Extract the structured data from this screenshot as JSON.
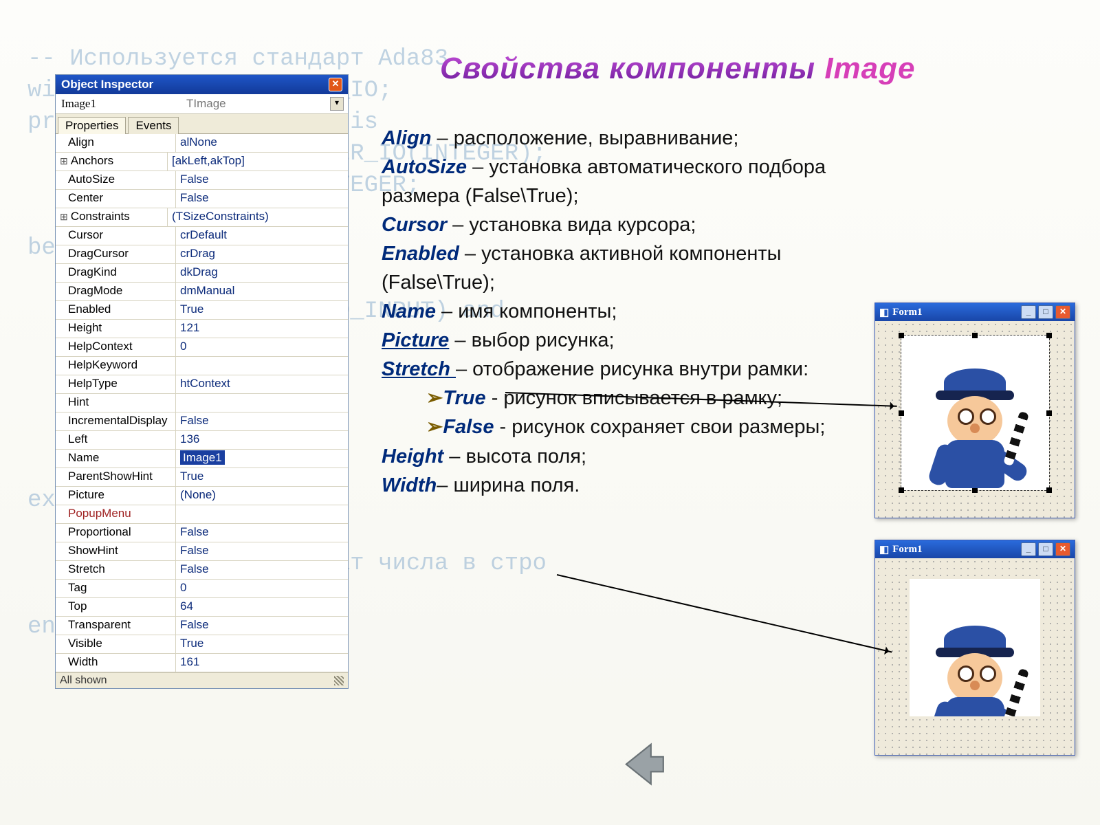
{
  "title": {
    "part1": "Свойства компоненты ",
    "part2": "Image"
  },
  "desc": {
    "align": {
      "k": "Align",
      "v": "расположение, выравнивание;"
    },
    "autosize": {
      "k": "AutoSize",
      "v": "установка автоматического подбора размера (False\\True);"
    },
    "cursor": {
      "k": "Cursor",
      "v": "установка вида курсора;"
    },
    "enabled": {
      "k": "Enabled",
      "v": "установка активной компоненты (False\\True);"
    },
    "name": {
      "k": "Name",
      "v": "имя компоненты;"
    },
    "picture": {
      "k": "Picture",
      "v": "выбор рисунка;"
    },
    "stretch": {
      "k": "Stretch ",
      "v": "отображение рисунка внутри рамки:"
    },
    "true": {
      "k": "True",
      "v": "рисунок вписывается в рамку;"
    },
    "false": {
      "k": "False",
      "v": "рисунок сохраняет свои размеры;"
    },
    "height": {
      "k": "Height",
      "v": "высота поля;"
    },
    "width": {
      "k": "Width",
      "v": "ширина поля."
    }
  },
  "inspector": {
    "title": "Object Inspector",
    "component": "Image1",
    "cls": "TImage",
    "tabs": [
      "Properties",
      "Events"
    ],
    "status": "All shown",
    "props": [
      {
        "k": "Align",
        "v": "alNone"
      },
      {
        "k": "Anchors",
        "v": "[akLeft,akTop]",
        "exp": true
      },
      {
        "k": "AutoSize",
        "v": "False"
      },
      {
        "k": "Center",
        "v": "False"
      },
      {
        "k": "Constraints",
        "v": "(TSizeConstraints)",
        "exp": true
      },
      {
        "k": "Cursor",
        "v": "crDefault"
      },
      {
        "k": "DragCursor",
        "v": "crDrag"
      },
      {
        "k": "DragKind",
        "v": "dkDrag"
      },
      {
        "k": "DragMode",
        "v": "dmManual"
      },
      {
        "k": "Enabled",
        "v": "True"
      },
      {
        "k": "Height",
        "v": "121"
      },
      {
        "k": "HelpContext",
        "v": "0"
      },
      {
        "k": "HelpKeyword",
        "v": ""
      },
      {
        "k": "HelpType",
        "v": "htContext"
      },
      {
        "k": "Hint",
        "v": ""
      },
      {
        "k": "IncrementalDisplay",
        "v": "False"
      },
      {
        "k": "Left",
        "v": "136"
      },
      {
        "k": "Name",
        "v": "Image1",
        "sel": true
      },
      {
        "k": "ParentShowHint",
        "v": "True"
      },
      {
        "k": "Picture",
        "v": "(None)"
      },
      {
        "k": "PopupMenu",
        "v": "",
        "red": true
      },
      {
        "k": "Proportional",
        "v": "False"
      },
      {
        "k": "ShowHint",
        "v": "False"
      },
      {
        "k": "Stretch",
        "v": "False"
      },
      {
        "k": "Tag",
        "v": "0"
      },
      {
        "k": "Top",
        "v": "64"
      },
      {
        "k": "Transparent",
        "v": "False"
      },
      {
        "k": "Visible",
        "v": "True"
      },
      {
        "k": "Width",
        "v": "161"
      }
    ]
  },
  "forms": {
    "caption": "Form1"
  }
}
